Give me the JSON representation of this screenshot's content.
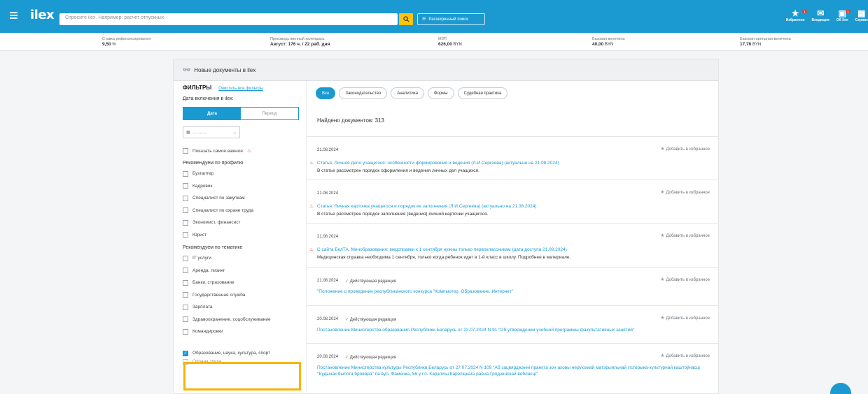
{
  "header": {
    "logo": "ilex",
    "search_placeholder": "Спросите ilex. Например: расчет отпускных",
    "advanced_search": "Расширенный поиск",
    "right_items": [
      {
        "label": "Избранное",
        "glyph": "★",
        "badge": "1",
        "icon": "star-icon"
      },
      {
        "label": "Входящие",
        "glyph": "✉",
        "badge": "",
        "icon": "inbox-icon"
      },
      {
        "label": "Об ilex",
        "glyph": "▣",
        "badge": "1",
        "icon": "about-icon"
      },
      {
        "label": "Сервис",
        "glyph": "▦",
        "badge": "",
        "icon": "service-icon"
      }
    ]
  },
  "info_strip": [
    {
      "label": "Ставка рефинансирования",
      "value": "9,50",
      "unit": "%"
    },
    {
      "label": "Производственный календарь",
      "value": "Август: 176 ч. / 22 раб. дня",
      "unit": ""
    },
    {
      "label": "МЗП",
      "value": "626,00",
      "unit": "BYN"
    },
    {
      "label": "Базовая величина",
      "value": "40,00",
      "unit": "BYN"
    },
    {
      "label": "Базовая арендная величина",
      "value": "17,76",
      "unit": "BYN"
    }
  ],
  "panel": {
    "title": "Новые документы в ilex"
  },
  "filters": {
    "title": "ФИЛЬТРЫ",
    "clear": "Очистить все фильтры",
    "date_label": "Дата включения в ilex:",
    "seg_date": "Дата",
    "seg_period": "Период",
    "date_value": "............",
    "important": "Показать самое важное",
    "profile_title": "Рекомендуем по профилю",
    "profile_items": [
      "Бухгалтер",
      "Кадровик",
      "Специалист по закупкам",
      "Специалист по охране труда",
      "Экономист, финансист",
      "Юрист"
    ],
    "topic_title": "Рекомендуем по тематике",
    "topic_items": [
      "IT услуги",
      "Аренда, лизинг",
      "Банки, страхование",
      "Государственная служба",
      "Зарплата",
      "Здравоохранение, соцобслуживание",
      "Командировки"
    ],
    "checked_item": "Образование, наука, культура, спорт",
    "partial_item": "Охрана труда"
  },
  "results": {
    "chips": [
      "Все",
      "Законодательство",
      "Аналитика",
      "Формы",
      "Судебная практика"
    ],
    "found": "Найдено документов: 313",
    "fav_label": "Добавить в избранное",
    "docs": [
      {
        "date": "21.08.2024",
        "status": "",
        "important": true,
        "title": "Статья. Личное дело учащегося: особенности формирования и ведения (Л.И.Сергеева) (актуально на 21.08.2024)",
        "desc": "В статье рассмотрен порядок оформления и ведения личных дел учащихся."
      },
      {
        "date": "21.08.2024",
        "status": "",
        "important": true,
        "title": "Статья. Личная карточка учащегося и порядок ее заполнения (Л.И.Сергеева) (актуально на 21.08.2024)",
        "desc": "В статье рассмотрен порядок заполнения (ведения) личной карточки учащегося."
      },
      {
        "date": "21.08.2024",
        "status": "",
        "important": true,
        "title": "С сайта БелТА. Минобразования: медсправки к 1 сентября нужны только первоклассникам (дата доступа 21.08.2024)",
        "desc": "Медицинская справка необходима 1 сентября, только когда ребенок идет в 1-й класс в школу. Подробнее в материале."
      },
      {
        "date": "21.08.2024",
        "status": "Действующая редакция",
        "important": false,
        "title": "\"Положение о проведении республиканского конкурса \"Компьютер. Образование. Интернет\"",
        "desc": ""
      },
      {
        "date": "20.08.2024",
        "status": "Действующая редакция",
        "important": false,
        "title": "Постановление Министерства образования Республики Беларусь от 22.07.2024 N 91 \"Об утверждении учебной программы факультативных занятий\"",
        "desc": ""
      },
      {
        "date": "20.08.2024",
        "status": "Действующая редакция",
        "important": false,
        "title": "Постановление Министерства культуры Республики Беларусь от 27.07.2024 N 109 \"Аб зацвярджэнні праекта зон аховы нерухомай матэрыяльнай гісторыка-культурнай каштоўнасці \"Будынак былога бровара\" па вул. Фаменка, 56 у г.п. Карэлічы Карэліцкага раёна Гродзенскай вобласці\"",
        "desc": ""
      }
    ]
  },
  "colors": {
    "brand": "#1b9ad1",
    "accent": "#ffc40c",
    "highlight": "#f7b500",
    "danger": "#e53b2f"
  }
}
